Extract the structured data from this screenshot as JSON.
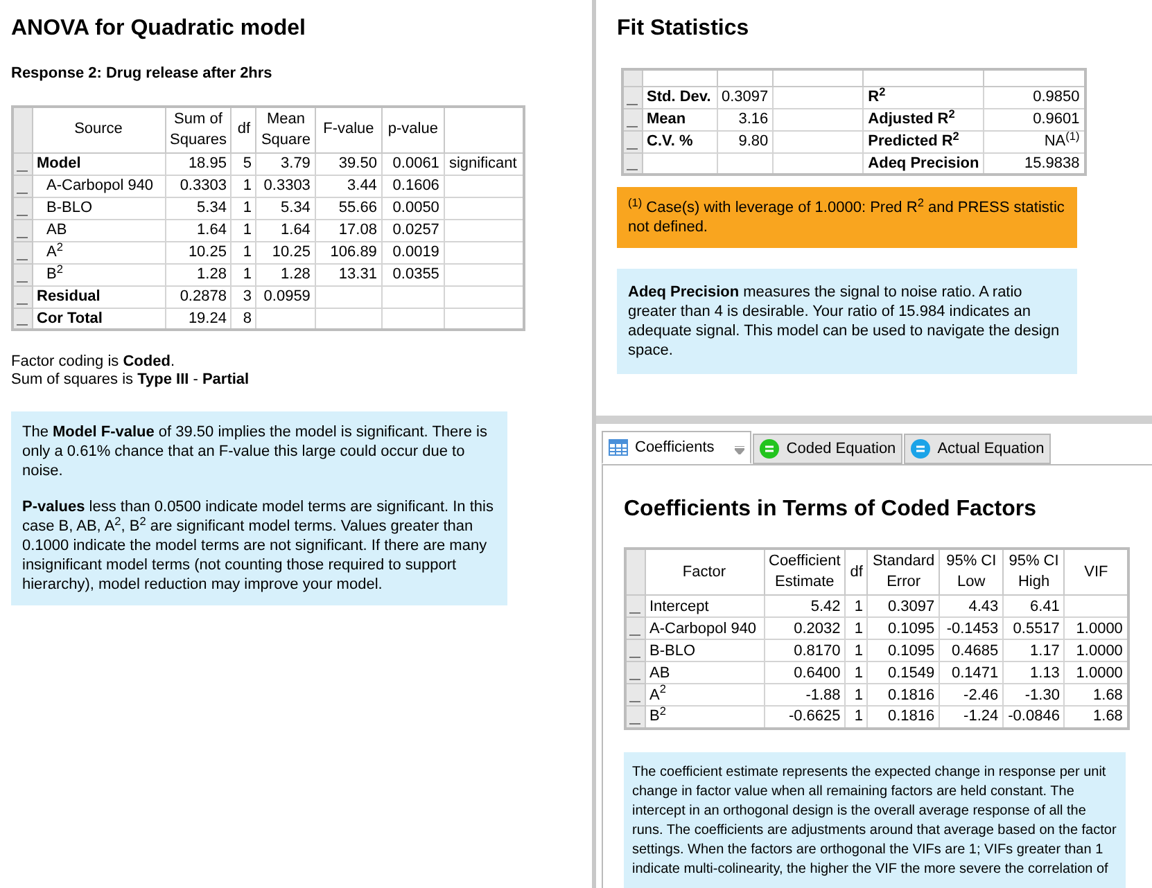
{
  "anova": {
    "title": "ANOVA for Quadratic model",
    "response": "Response 2: Drug release after 2hrs",
    "table": {
      "columns": [
        "Source",
        "Sum of Squares",
        "df",
        "Mean Square",
        "F-value",
        "p-value"
      ],
      "rows": [
        {
          "kind": "summary",
          "cells": [
            "Model",
            "18.95",
            "5",
            "3.79",
            "39.50",
            "0.0061",
            "significant"
          ]
        },
        {
          "kind": "term",
          "cells": [
            "A-Carbopol 940",
            "0.3303",
            "1",
            "0.3303",
            "3.44",
            "0.1606",
            null
          ]
        },
        {
          "kind": "term",
          "cells": [
            "B-BLO",
            "5.34",
            "1",
            "5.34",
            "55.66",
            "0.0050",
            null
          ]
        },
        {
          "kind": "term",
          "cells": [
            "AB",
            "1.64",
            "1",
            "1.64",
            "17.08",
            "0.0257",
            null
          ]
        },
        {
          "kind": "term",
          "cells": [
            "A$^{2}$",
            "10.25",
            "1",
            "10.25",
            "106.89",
            "0.0019",
            null
          ]
        },
        {
          "kind": "term",
          "cells": [
            "B$^{2}$",
            "1.28",
            "1",
            "1.28",
            "13.31",
            "0.0355",
            null
          ]
        },
        {
          "kind": "summary",
          "cells": [
            "Residual",
            "0.2878",
            "3",
            "0.0959",
            null,
            null,
            null
          ]
        },
        {
          "kind": "summary",
          "cells": [
            "Cor Total",
            "19.24",
            "8",
            null,
            null,
            null,
            null
          ]
        }
      ]
    },
    "notes": [
      "Factor coding is **Coded**.",
      "Sum of squares is **Type III** - **Partial**"
    ],
    "info": [
      "The **Model F-value** of 39.50 implies the model is significant. There is only a 0.61% chance that an F-value this large could occur due to noise.",
      "**P-values** less than 0.0500 indicate model terms are significant. In this case B, AB, A$^{2}$, B$^{2}$ are significant model terms. Values greater than 0.1000 indicate the model terms are not significant. If there are many insignificant model terms (not counting those required to support hierarchy), model reduction may improve your model."
    ]
  },
  "fit": {
    "title": "Fit Statistics",
    "rows": [
      {
        "cells": [
          "Std. Dev.",
          "0.3097",
          null,
          "R$^{2}$",
          "0.9850"
        ]
      },
      {
        "cells": [
          "Mean",
          "3.16",
          null,
          "Adjusted R$^{2}$",
          "0.9601"
        ]
      },
      {
        "cells": [
          "C.V. %",
          "9.80",
          null,
          "Predicted R$^{2}$",
          "NA$^{(1)}$"
        ]
      },
      {
        "cells": [
          null,
          null,
          null,
          "Adeq Precision",
          "15.9838"
        ]
      }
    ],
    "footnote": "$^{(1)}$ Case(s) with leverage of 1.0000: Pred R$^{2}$ and PRESS statistic not defined.",
    "info": "**Adeq Precision** measures the signal to noise ratio. A ratio greater than 4 is desirable. Your ratio of 15.984 indicates an adequate signal. This model can be used to navigate the design space."
  },
  "coefficients": {
    "tabs": [
      {
        "label": "Coefficients",
        "kind": "table",
        "selected": true
      },
      {
        "label": "Coded Equation",
        "kind": "equation",
        "color": "#22c41e",
        "selected": false
      },
      {
        "label": "Actual Equation",
        "kind": "equation",
        "color": "#1aa3e8",
        "selected": false
      }
    ],
    "title": "Coefficients in Terms of Coded Factors",
    "table": {
      "columns": [
        "Factor",
        "Coefficient Estimate",
        "df",
        "Standard Error",
        "95% CI Low",
        "95% CI High",
        "VIF"
      ],
      "rows": [
        {
          "cells": [
            "Intercept",
            "5.42",
            "1",
            "0.3097",
            "4.43",
            "6.41",
            null
          ]
        },
        {
          "cells": [
            "A-Carbopol 940",
            "0.2032",
            "1",
            "0.1095",
            "-0.1453",
            "0.5517",
            "1.0000"
          ]
        },
        {
          "cells": [
            "B-BLO",
            "0.8170",
            "1",
            "0.1095",
            "0.4685",
            "1.17",
            "1.0000"
          ]
        },
        {
          "cells": [
            "AB",
            "0.6400",
            "1",
            "0.1549",
            "0.1471",
            "1.13",
            "1.0000"
          ]
        },
        {
          "cells": [
            "A$^{2}$",
            "-1.88",
            "1",
            "0.1816",
            "-2.46",
            "-1.30",
            "1.68"
          ]
        },
        {
          "cells": [
            "B$^{2}$",
            "-0.6625",
            "1",
            "0.1816",
            "-1.24",
            "-0.0846",
            "1.68"
          ]
        }
      ]
    },
    "info": "The coefficient estimate represents the expected change in response per unit change in factor value when all remaining factors are held constant. The intercept in an orthogonal design is the overall average response of all the runs. The coefficients are adjustments around that average based on the factor settings. When the factors are orthogonal the VIFs are 1; VIFs greater than 1 indicate multi-colinearity, the higher the VIF the more severe the correlation of"
  }
}
